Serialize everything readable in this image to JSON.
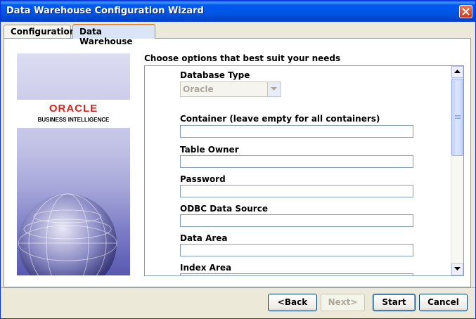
{
  "window": {
    "title": "Data Warehouse Configuration Wizard"
  },
  "tabs": [
    {
      "label": "Configuration"
    },
    {
      "label": "Data Warehouse"
    }
  ],
  "branding": {
    "logo_word": "ORACLE",
    "logo_sub": "BUSINESS INTELLIGENCE"
  },
  "form": {
    "heading": "Choose options that best suit your needs",
    "database_type": {
      "label": "Database Type",
      "value": "Oracle"
    },
    "container": {
      "label": "Container (leave empty for all containers)",
      "value": ""
    },
    "table_owner": {
      "label": "Table Owner",
      "value": ""
    },
    "password": {
      "label": "Password",
      "value": ""
    },
    "odbc": {
      "label": "ODBC Data Source",
      "value": ""
    },
    "data_area": {
      "label": "Data Area",
      "value": ""
    },
    "index_area": {
      "label": "Index Area",
      "value": ""
    }
  },
  "buttons": {
    "back": "<Back",
    "next": "Next>",
    "start": "Start",
    "cancel": "Cancel"
  }
}
